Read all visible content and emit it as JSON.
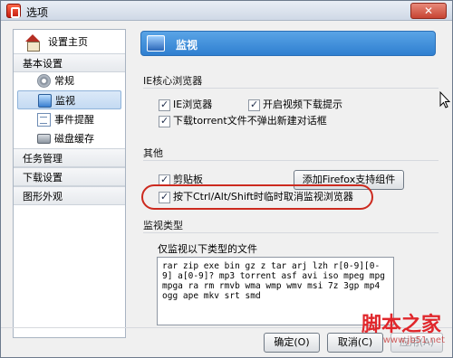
{
  "window": {
    "title": "选项",
    "close_label": "✕"
  },
  "sidebar": {
    "home": "设置主页",
    "categories": [
      "基本设置",
      "任务管理",
      "下载设置",
      "图形外观"
    ],
    "sub_items": [
      "常规",
      "监视",
      "事件提醒",
      "磁盘缓存"
    ],
    "selected": "监视"
  },
  "banner": {
    "title": "监视"
  },
  "sections": {
    "ie": "IE核心浏览器",
    "other": "其他",
    "types": "监视类型"
  },
  "checkboxes": {
    "ie_browser": "IE浏览器",
    "video_tip": "开启视频下载提示",
    "torrent_no_dialog": "下载torrent文件不弹出新建对话框",
    "clipboard": "剪贴板",
    "hotkey_cancel": "按下Ctrl/Alt/Shift时临时取消监视浏览器"
  },
  "buttons": {
    "add_firefox": "添加Firefox支持组件",
    "ok": "确定(O)",
    "cancel": "取消(C)",
    "apply": "应用(A)"
  },
  "filetypes": {
    "label": "仅监视以下类型的文件",
    "value": "rar zip exe bin gz z tar arj lzh r[0-9][0-9] a[0-9]? mp3 torrent asf avi iso mpeg mpg mpga ra rm rmvb wma wmp wmv msi 7z 3gp mp4 ogg ape mkv srt smd"
  },
  "watermark": {
    "title": "脚本之家",
    "url": "www.jb51.net"
  }
}
